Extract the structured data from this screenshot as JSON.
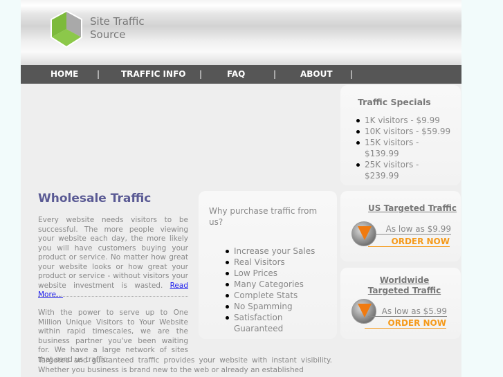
{
  "logo": {
    "line1": "Site Traffic",
    "line2": "Source"
  },
  "nav": {
    "items": [
      "HOME",
      "TRAFFIC INFO",
      "FAQ",
      "ABOUT"
    ],
    "separator": "|"
  },
  "specials": {
    "title": "Traffic Specials",
    "items": [
      "1K visitors -   $9.99",
      "10K visitors -  $59.99",
      "15K visitors - $139.99",
      "25K visitors - $239.99"
    ]
  },
  "main": {
    "title": "Wholesale Traffic",
    "p1": "Every website needs visitors to be successful. The more people viewing your website each day, the more likely you will have customers buying your product or service. No matter how great your website looks or how great your product or service - without visitors your website investment is wasted.",
    "read_more": "Read More...",
    "p2": "With the power to serve up to One Million Unique Visitors to Your Website within rapid timescales, we are the business partner you've been waiting for. We have a large network of sites that send us traffic,",
    "p3": "Targeted and guaranteed traffic provides your website with instant visibility. Whether you business is brand new to the web or already an established"
  },
  "why": {
    "title": "Why purchase traffic from us?",
    "items": [
      "Increase your Sales",
      "Real Visitors",
      "Low Prices",
      "Many Categories",
      "Complete Stats",
      "No Spamming",
      "Satisfaction Guaranteed"
    ]
  },
  "offers": [
    {
      "title": "US Targeted Traffic",
      "price": "As low as $9.99",
      "cta": "ORDER NOW"
    },
    {
      "title": "Worldwide Targeted Traffic",
      "price": "As low as $5.99",
      "cta": "ORDER NOW"
    }
  ],
  "colors": {
    "nav": "#565656",
    "title": "#5a5a94",
    "order": "#f59a1b"
  }
}
